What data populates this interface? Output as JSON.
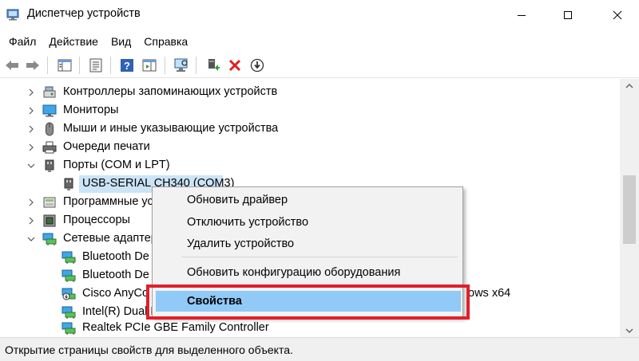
{
  "window": {
    "title": "Диспетчер устройств",
    "accent_color": "#e0202a"
  },
  "menu": [
    "Файл",
    "Действие",
    "Вид",
    "Справка"
  ],
  "toolbar": {
    "icons": [
      "back-arrow-icon",
      "forward-arrow-icon",
      "console-tree-icon",
      "properties-icon",
      "help-icon",
      "action-pane-icon",
      "scan-hardware-icon",
      "update-driver-icon",
      "uninstall-device-icon",
      "disable-device-icon"
    ]
  },
  "tree": {
    "rows": [
      {
        "label": "Контроллеры запоминающих устройств",
        "icon": "storage-controller-icon",
        "expanded": false
      },
      {
        "label": "Мониторы",
        "icon": "monitor-icon",
        "expanded": false
      },
      {
        "label": "Мыши и иные указывающие устройства",
        "icon": "mouse-icon",
        "expanded": false
      },
      {
        "label": "Очереди печати",
        "icon": "printer-icon",
        "expanded": false
      },
      {
        "label": "Порты (COM и LPT)",
        "icon": "port-icon",
        "expanded": true
      },
      {
        "label": "USB-SERIAL CH340 (COM3)",
        "icon": "port-icon",
        "selected": true
      },
      {
        "label": "Программные ус",
        "icon": "software-device-icon",
        "expanded": false
      },
      {
        "label": "Процессоры",
        "icon": "processor-icon",
        "expanded": false
      },
      {
        "label": "Сетевые адаптер",
        "icon": "network-adapter-icon",
        "expanded": true
      },
      {
        "label": "Bluetooth De",
        "icon": "network-adapter-icon"
      },
      {
        "label": "Bluetooth De",
        "icon": "network-adapter-icon"
      },
      {
        "label": "Cisco AnyCo",
        "suffix": "ows x64",
        "icon": "network-adapter-disabled-icon"
      },
      {
        "label": "Intel(R) Dual E",
        "icon": "network-adapter-icon"
      },
      {
        "label": "Realtek PCIe GBE Family Controller",
        "icon": "network-adapter-icon"
      }
    ]
  },
  "context_menu": {
    "items": [
      "Обновить драйвер",
      "Отключить устройство",
      "Удалить устройство",
      "Обновить конфигурацию оборудования",
      "Свойства"
    ],
    "highlighted": "Свойства"
  },
  "statusbar": {
    "text": "Открытие страницы свойств для выделенного объекта."
  }
}
